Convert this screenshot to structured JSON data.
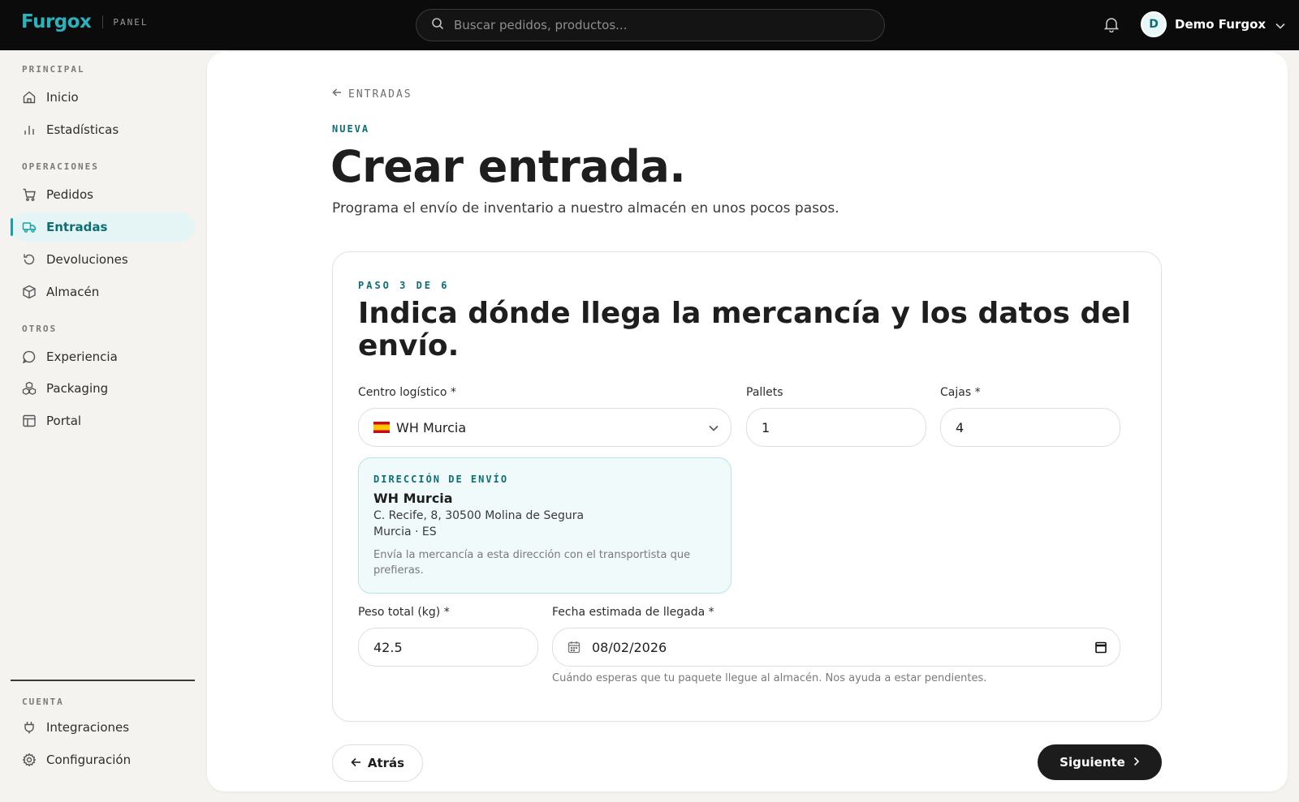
{
  "header": {
    "brand": "Furgox",
    "brand_tag": "PANEL",
    "search_placeholder": "Buscar pedidos, productos...",
    "user_initial": "D",
    "user_name": "Demo Furgox"
  },
  "sidebar": {
    "sections": [
      {
        "label": "PRINCIPAL",
        "items": [
          {
            "label": "Inicio",
            "icon": "home-icon"
          },
          {
            "label": "Estadísticas",
            "icon": "bar-chart-icon"
          }
        ]
      },
      {
        "label": "OPERACIONES",
        "items": [
          {
            "label": "Pedidos",
            "icon": "cart-icon"
          },
          {
            "label": "Entradas",
            "icon": "truck-icon",
            "active": true
          },
          {
            "label": "Devoluciones",
            "icon": "return-icon"
          },
          {
            "label": "Almacén",
            "icon": "box-icon"
          }
        ]
      },
      {
        "label": "OTROS",
        "items": [
          {
            "label": "Experiencia",
            "icon": "chat-icon"
          },
          {
            "label": "Packaging",
            "icon": "packages-icon"
          },
          {
            "label": "Portal",
            "icon": "layout-icon"
          }
        ]
      },
      {
        "label": "CUENTA",
        "items": [
          {
            "label": "Integraciones",
            "icon": "plug-icon"
          },
          {
            "label": "Configuración",
            "icon": "gear-icon"
          }
        ]
      }
    ]
  },
  "main": {
    "back_label": "ENTRADAS",
    "kicker": "NUEVA",
    "title": "Crear entrada.",
    "subtitle": "Programa el envío de inventario a nuestro almacén en unos pocos pasos.",
    "step": {
      "label": "PASO 3 DE 6",
      "title": "Indica dónde llega la mercancía y los datos del envío.",
      "center_label": "Centro logístico *",
      "center_value": "WH Murcia",
      "pallets_label": "Pallets",
      "pallets_value": "1",
      "boxes_label": "Cajas *",
      "boxes_value": "4",
      "address": {
        "kicker": "DIRECCIÓN DE ENVÍO",
        "name": "WH Murcia",
        "line1": "C. Recife, 8, 30500 Molina de Segura",
        "line2": "Murcia · ES",
        "note": "Envía la mercancía a esta dirección con el transportista que prefieras."
      },
      "weight_label": "Peso total (kg) *",
      "weight_value": "42.5",
      "date_label": "Fecha estimada de llegada *",
      "date_value": "08/02/2026",
      "date_helper": "Cuándo esperas que tu paquete llegue al almacén. Nos ayuda a estar pendientes."
    },
    "back_button": "Atrás",
    "next_button": "Siguiente"
  },
  "colors": {
    "accent": "#0d6e75",
    "accent_light": "#e5f4f5",
    "brand": "#2bb3bd",
    "topbar": "#0b0b0b"
  }
}
